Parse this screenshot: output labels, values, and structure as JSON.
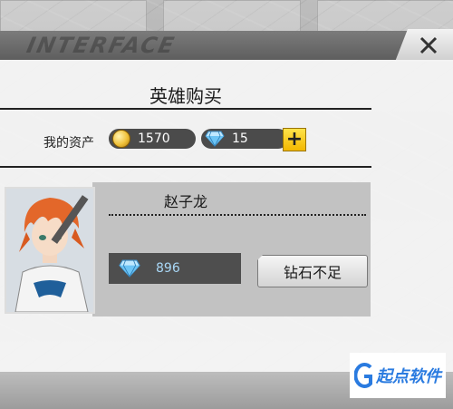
{
  "header": {
    "deco_text": "INTERFACE"
  },
  "dialog": {
    "title": "英雄购买"
  },
  "assets": {
    "label": "我的资产",
    "gold": "1570",
    "diamonds": "15",
    "add_label": "+"
  },
  "hero": {
    "name": "赵子龙",
    "price": "896",
    "action_label": "钻石不足"
  },
  "watermark": {
    "text": "起点软件"
  },
  "colors": {
    "diamond": "#7fd1ff",
    "gold": "#f0c23a",
    "plus_button": "#ffd21a"
  }
}
